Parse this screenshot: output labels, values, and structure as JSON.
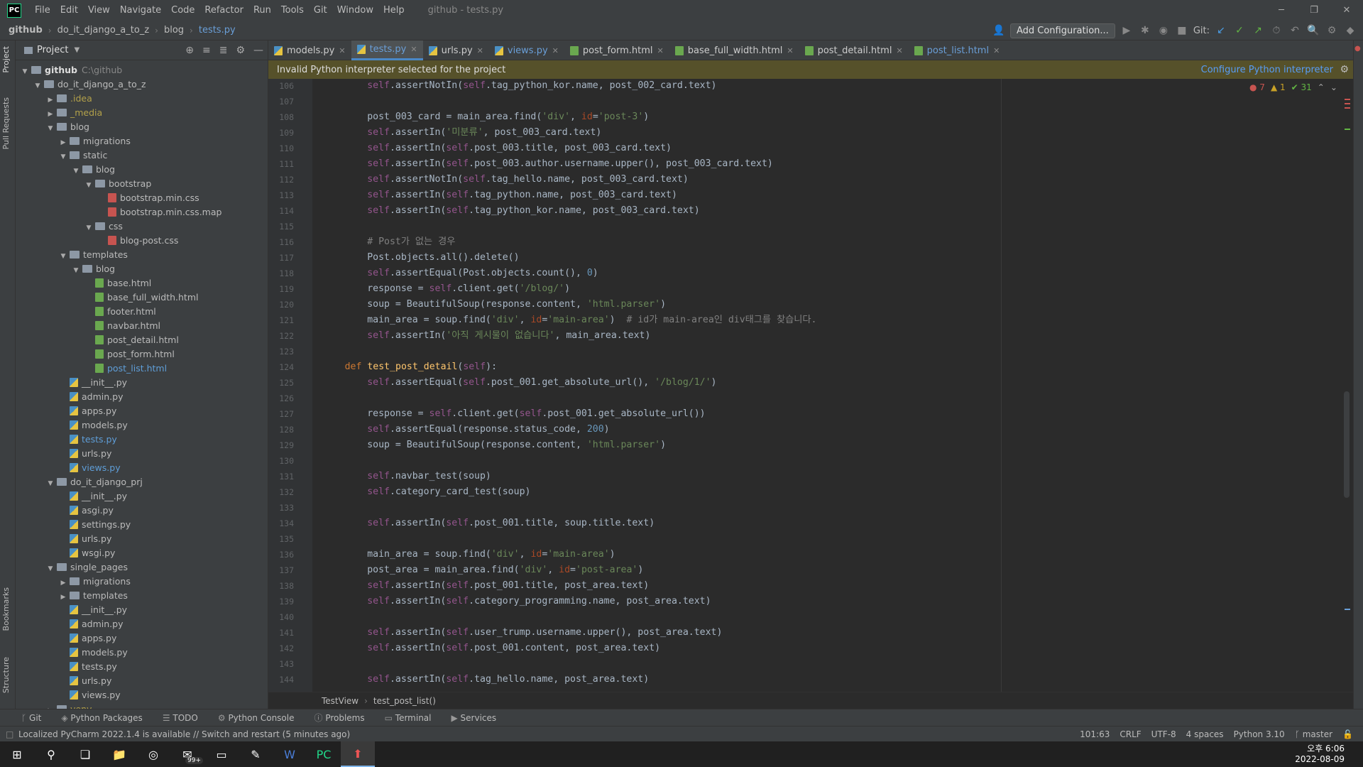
{
  "titlebar": {
    "logo": "PC",
    "menu": [
      "File",
      "Edit",
      "View",
      "Navigate",
      "Code",
      "Refactor",
      "Run",
      "Tools",
      "Git",
      "Window",
      "Help"
    ],
    "title": "github - tests.py"
  },
  "navbar": {
    "breadcrumb": [
      "github",
      "do_it_django_a_to_z",
      "blog",
      "tests.py"
    ],
    "add_configuration": "Add Configuration...",
    "git_label": "Git:"
  },
  "project": {
    "title": "Project",
    "tree": [
      {
        "d": 0,
        "a": "v",
        "t": "folder",
        "label": "github",
        "suffix": "C:\\github",
        "bold": true
      },
      {
        "d": 1,
        "a": "v",
        "t": "folder",
        "label": "do_it_django_a_to_z"
      },
      {
        "d": 2,
        "a": ">",
        "t": "folder",
        "label": ".idea",
        "style": "yel"
      },
      {
        "d": 2,
        "a": ">",
        "t": "folder",
        "label": "_media",
        "style": "yel"
      },
      {
        "d": 2,
        "a": "v",
        "t": "folder",
        "label": "blog"
      },
      {
        "d": 3,
        "a": ">",
        "t": "folder",
        "label": "migrations"
      },
      {
        "d": 3,
        "a": "v",
        "t": "folder",
        "label": "static"
      },
      {
        "d": 4,
        "a": "v",
        "t": "folder",
        "label": "blog"
      },
      {
        "d": 5,
        "a": "v",
        "t": "folder",
        "label": "bootstrap"
      },
      {
        "d": 6,
        "a": "",
        "t": "css",
        "label": "bootstrap.min.css"
      },
      {
        "d": 6,
        "a": "",
        "t": "css",
        "label": "bootstrap.min.css.map"
      },
      {
        "d": 5,
        "a": "v",
        "t": "folder",
        "label": "css"
      },
      {
        "d": 6,
        "a": "",
        "t": "css",
        "label": "blog-post.css"
      },
      {
        "d": 3,
        "a": "v",
        "t": "folder",
        "label": "templates"
      },
      {
        "d": 4,
        "a": "v",
        "t": "folder",
        "label": "blog"
      },
      {
        "d": 5,
        "a": "",
        "t": "html",
        "label": "base.html"
      },
      {
        "d": 5,
        "a": "",
        "t": "html",
        "label": "base_full_width.html"
      },
      {
        "d": 5,
        "a": "",
        "t": "html",
        "label": "footer.html"
      },
      {
        "d": 5,
        "a": "",
        "t": "html",
        "label": "navbar.html"
      },
      {
        "d": 5,
        "a": "",
        "t": "html",
        "label": "post_detail.html"
      },
      {
        "d": 5,
        "a": "",
        "t": "html",
        "label": "post_form.html"
      },
      {
        "d": 5,
        "a": "",
        "t": "html",
        "label": "post_list.html",
        "style": "blue"
      },
      {
        "d": 3,
        "a": "",
        "t": "py",
        "label": "__init__.py"
      },
      {
        "d": 3,
        "a": "",
        "t": "py",
        "label": "admin.py"
      },
      {
        "d": 3,
        "a": "",
        "t": "py",
        "label": "apps.py"
      },
      {
        "d": 3,
        "a": "",
        "t": "py",
        "label": "models.py"
      },
      {
        "d": 3,
        "a": "",
        "t": "py",
        "label": "tests.py",
        "style": "blue"
      },
      {
        "d": 3,
        "a": "",
        "t": "py",
        "label": "urls.py"
      },
      {
        "d": 3,
        "a": "",
        "t": "py",
        "label": "views.py",
        "style": "blue"
      },
      {
        "d": 2,
        "a": "v",
        "t": "folder",
        "label": "do_it_django_prj"
      },
      {
        "d": 3,
        "a": "",
        "t": "py",
        "label": "__init__.py"
      },
      {
        "d": 3,
        "a": "",
        "t": "py",
        "label": "asgi.py"
      },
      {
        "d": 3,
        "a": "",
        "t": "py",
        "label": "settings.py"
      },
      {
        "d": 3,
        "a": "",
        "t": "py",
        "label": "urls.py"
      },
      {
        "d": 3,
        "a": "",
        "t": "py",
        "label": "wsgi.py"
      },
      {
        "d": 2,
        "a": "v",
        "t": "folder",
        "label": "single_pages"
      },
      {
        "d": 3,
        "a": ">",
        "t": "folder",
        "label": "migrations"
      },
      {
        "d": 3,
        "a": ">",
        "t": "folder",
        "label": "templates"
      },
      {
        "d": 3,
        "a": "",
        "t": "py",
        "label": "__init__.py"
      },
      {
        "d": 3,
        "a": "",
        "t": "py",
        "label": "admin.py"
      },
      {
        "d": 3,
        "a": "",
        "t": "py",
        "label": "apps.py"
      },
      {
        "d": 3,
        "a": "",
        "t": "py",
        "label": "models.py"
      },
      {
        "d": 3,
        "a": "",
        "t": "py",
        "label": "tests.py"
      },
      {
        "d": 3,
        "a": "",
        "t": "py",
        "label": "urls.py"
      },
      {
        "d": 3,
        "a": "",
        "t": "py",
        "label": "views.py"
      },
      {
        "d": 2,
        "a": ">",
        "t": "folder",
        "label": "venv",
        "style": "yel"
      }
    ]
  },
  "left_stripe": {
    "project": "Project",
    "pull_requests": "Pull Requests",
    "bookmarks": "Bookmarks",
    "structure": "Structure"
  },
  "tabs": [
    {
      "label": "models.py",
      "icon": "py"
    },
    {
      "label": "tests.py",
      "icon": "py",
      "active": true,
      "blue": true
    },
    {
      "label": "urls.py",
      "icon": "py"
    },
    {
      "label": "views.py",
      "icon": "py",
      "blue": true
    },
    {
      "label": "post_form.html",
      "icon": "html"
    },
    {
      "label": "base_full_width.html",
      "icon": "html"
    },
    {
      "label": "post_detail.html",
      "icon": "html"
    },
    {
      "label": "post_list.html",
      "icon": "html",
      "blue": true
    }
  ],
  "warning": {
    "text": "Invalid Python interpreter selected for the project",
    "action": "Configure Python interpreter"
  },
  "inspections": {
    "errors": "7",
    "warnings": "1",
    "ok": "31"
  },
  "code": {
    "first_line": 106,
    "lines": [
      [
        [
          8,
          ""
        ],
        [
          "sf",
          "self"
        ],
        [
          "",
          "."
        ],
        [
          "",
          "assertNotIn("
        ],
        [
          "sf",
          "self"
        ],
        [
          "",
          ".tag_python_kor.name, post_002_card.text)"
        ]
      ],
      [],
      [
        [
          8,
          ""
        ],
        [
          "",
          "post_003_card = main_area.find("
        ],
        [
          "s",
          "'div'"
        ],
        [
          "",
          ", "
        ],
        [
          "p",
          "id"
        ],
        [
          "",
          "="
        ],
        [
          "s",
          "'post-3'"
        ],
        [
          "",
          ")"
        ]
      ],
      [
        [
          8,
          ""
        ],
        [
          "sf",
          "self"
        ],
        [
          "",
          ".assertIn("
        ],
        [
          "s",
          "'미분류'"
        ],
        [
          "",
          ", post_003_card.text)"
        ]
      ],
      [
        [
          8,
          ""
        ],
        [
          "sf",
          "self"
        ],
        [
          "",
          ".assertIn("
        ],
        [
          "sf",
          "self"
        ],
        [
          "",
          ".post_003.title, post_003_card.text)"
        ]
      ],
      [
        [
          8,
          ""
        ],
        [
          "sf",
          "self"
        ],
        [
          "",
          ".assertIn("
        ],
        [
          "sf",
          "self"
        ],
        [
          "",
          ".post_003.author.username.upper(), post_003_card.text)"
        ]
      ],
      [
        [
          8,
          ""
        ],
        [
          "sf",
          "self"
        ],
        [
          "",
          ".assertNotIn("
        ],
        [
          "sf",
          "self"
        ],
        [
          "",
          ".tag_hello.name, post_003_card.text)"
        ]
      ],
      [
        [
          8,
          ""
        ],
        [
          "sf",
          "self"
        ],
        [
          "",
          ".assertIn("
        ],
        [
          "sf",
          "self"
        ],
        [
          "",
          ".tag_python.name, post_003_card.text)"
        ]
      ],
      [
        [
          8,
          ""
        ],
        [
          "sf",
          "self"
        ],
        [
          "",
          ".assertIn("
        ],
        [
          "sf",
          "self"
        ],
        [
          "",
          ".tag_python_kor.name, post_003_card.text)"
        ]
      ],
      [],
      [
        [
          8,
          ""
        ],
        [
          "c",
          "# Post가 없는 경우"
        ]
      ],
      [
        [
          8,
          ""
        ],
        [
          "",
          "Post.objects.all().delete()"
        ]
      ],
      [
        [
          8,
          ""
        ],
        [
          "sf",
          "self"
        ],
        [
          "",
          ".assertEqual(Post.objects.count(), "
        ],
        [
          "n",
          "0"
        ],
        [
          "",
          ")"
        ]
      ],
      [
        [
          8,
          ""
        ],
        [
          "",
          "response = "
        ],
        [
          "sf",
          "self"
        ],
        [
          "",
          ".client.get("
        ],
        [
          "s",
          "'/blog/'"
        ],
        [
          "",
          ")"
        ]
      ],
      [
        [
          8,
          ""
        ],
        [
          "",
          "soup = BeautifulSoup(response.content, "
        ],
        [
          "s",
          "'html.parser'"
        ],
        [
          "",
          ")"
        ]
      ],
      [
        [
          8,
          ""
        ],
        [
          "",
          "main_area = soup.find("
        ],
        [
          "s",
          "'div'"
        ],
        [
          "",
          ", "
        ],
        [
          "p",
          "id"
        ],
        [
          "",
          "="
        ],
        [
          "s",
          "'main-area'"
        ],
        [
          "",
          ")  "
        ],
        [
          "c",
          "# id가 main-area인 div태그를 찾습니다."
        ]
      ],
      [
        [
          8,
          ""
        ],
        [
          "sf",
          "self"
        ],
        [
          "",
          ".assertIn("
        ],
        [
          "s",
          "'아직 게시물이 없습니다'"
        ],
        [
          "",
          ", main_area.text)"
        ]
      ],
      [],
      [
        [
          4,
          ""
        ],
        [
          "k",
          "def "
        ],
        [
          "f",
          "test_post_detail"
        ],
        [
          "",
          "("
        ],
        [
          "sf",
          "self"
        ],
        [
          "",
          "):"
        ]
      ],
      [
        [
          8,
          ""
        ],
        [
          "sf",
          "self"
        ],
        [
          "",
          ".assertEqual("
        ],
        [
          "sf",
          "self"
        ],
        [
          "",
          ".post_001.get_absolute_url(), "
        ],
        [
          "s",
          "'/blog/1/'"
        ],
        [
          "",
          ")"
        ]
      ],
      [],
      [
        [
          8,
          ""
        ],
        [
          "",
          "response = "
        ],
        [
          "sf",
          "self"
        ],
        [
          "",
          ".client.get("
        ],
        [
          "sf",
          "self"
        ],
        [
          "",
          ".post_001.get_absolute_url())"
        ]
      ],
      [
        [
          8,
          ""
        ],
        [
          "sf",
          "self"
        ],
        [
          "",
          ".assertEqual(response.status_code, "
        ],
        [
          "n",
          "200"
        ],
        [
          "",
          ")"
        ]
      ],
      [
        [
          8,
          ""
        ],
        [
          "",
          "soup = BeautifulSoup(response.content, "
        ],
        [
          "s",
          "'html.parser'"
        ],
        [
          "",
          ")"
        ]
      ],
      [],
      [
        [
          8,
          ""
        ],
        [
          "sf",
          "self"
        ],
        [
          "",
          ".navbar_test(soup)"
        ]
      ],
      [
        [
          8,
          ""
        ],
        [
          "sf",
          "self"
        ],
        [
          "",
          ".category_card_test(soup)"
        ]
      ],
      [],
      [
        [
          8,
          ""
        ],
        [
          "sf",
          "self"
        ],
        [
          "",
          ".assertIn("
        ],
        [
          "sf",
          "self"
        ],
        [
          "",
          ".post_001.title, soup.title.text)"
        ]
      ],
      [],
      [
        [
          8,
          ""
        ],
        [
          "",
          "main_area = soup.find("
        ],
        [
          "s",
          "'div'"
        ],
        [
          "",
          ", "
        ],
        [
          "p",
          "id"
        ],
        [
          "",
          "="
        ],
        [
          "s",
          "'main-area'"
        ],
        [
          "",
          ")"
        ]
      ],
      [
        [
          8,
          ""
        ],
        [
          "",
          "post_area = main_area.find("
        ],
        [
          "s",
          "'div'"
        ],
        [
          "",
          ", "
        ],
        [
          "p",
          "id"
        ],
        [
          "",
          "="
        ],
        [
          "s",
          "'post-area'"
        ],
        [
          "",
          ")"
        ]
      ],
      [
        [
          8,
          ""
        ],
        [
          "sf",
          "self"
        ],
        [
          "",
          ".assertIn("
        ],
        [
          "sf",
          "self"
        ],
        [
          "",
          ".post_001.title, post_area.text)"
        ]
      ],
      [
        [
          8,
          ""
        ],
        [
          "sf",
          "self"
        ],
        [
          "",
          ".assertIn("
        ],
        [
          "sf",
          "self"
        ],
        [
          "",
          ".category_programming.name, post_area.text)"
        ]
      ],
      [],
      [
        [
          8,
          ""
        ],
        [
          "sf",
          "self"
        ],
        [
          "",
          ".assertIn("
        ],
        [
          "sf",
          "self"
        ],
        [
          "",
          ".user_trump.username.upper(), post_area.text)"
        ]
      ],
      [
        [
          8,
          ""
        ],
        [
          "sf",
          "self"
        ],
        [
          "",
          ".assertIn("
        ],
        [
          "sf",
          "self"
        ],
        [
          "",
          ".post_001.content, post_area.text)"
        ]
      ],
      [],
      [
        [
          8,
          ""
        ],
        [
          "sf",
          "self"
        ],
        [
          "",
          ".assertIn("
        ],
        [
          "sf",
          "self"
        ],
        [
          "",
          ".tag_hello.name, post_area.text)"
        ]
      ]
    ]
  },
  "editor_breadcrumb": [
    "TestView",
    "test_post_list()"
  ],
  "tool_windows": [
    "Git",
    "Python Packages",
    "TODO",
    "Python Console",
    "Problems",
    "Terminal",
    "Services"
  ],
  "status": {
    "message": "Localized PyCharm 2022.1.4 is available // Switch and restart (5 minutes ago)",
    "position": "101:63",
    "line_sep": "CRLF",
    "encoding": "UTF-8",
    "indent": "4 spaces",
    "interpreter": "Python 3.10",
    "branch": "master"
  },
  "taskbar": {
    "time": "오후 6:06",
    "date": "2022-08-09",
    "mail_badge": "99+"
  }
}
